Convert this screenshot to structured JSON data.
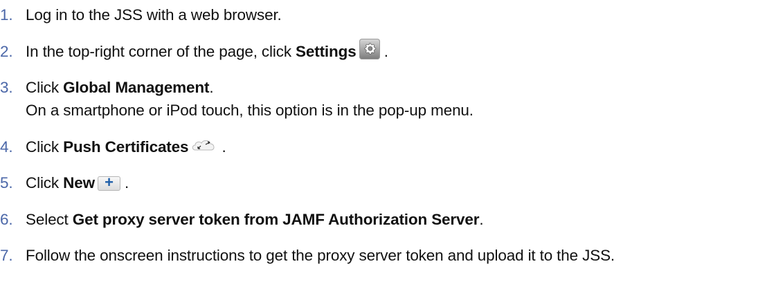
{
  "steps": [
    {
      "number": "1",
      "dot": ".",
      "text": "Log in to the JSS with a web browser."
    },
    {
      "number": "2",
      "dot": ".",
      "text_before": "In the top-right corner of the page, click",
      "bold": "Settings",
      "icon": "gear-icon",
      "text_after": "."
    },
    {
      "number": "3",
      "dot": ".",
      "text_before": "Click",
      "bold": "Global Management",
      "text_after": ".",
      "note": "On a smartphone or iPod touch, this option is in the pop-up menu."
    },
    {
      "number": "4",
      "dot": ".",
      "text_before": "Click",
      "bold": "Push Certificates",
      "icon": "cloud-icon",
      "text_after": "."
    },
    {
      "number": "5",
      "dot": ".",
      "text_before": "Click",
      "bold": "New",
      "icon": "plus-icon",
      "icon_text": "+",
      "text_after": "."
    },
    {
      "number": "6",
      "dot": ".",
      "text_before": "Select",
      "bold": "Get proxy server token from JAMF Authorization Server",
      "text_after": "."
    },
    {
      "number": "7",
      "dot": ".",
      "text": "Follow the onscreen instructions to get the proxy server token and upload it to the JSS."
    }
  ],
  "colors": {
    "step_number": "#4b67a8",
    "text": "#111111",
    "plus_icon": "#1e5ea8"
  }
}
